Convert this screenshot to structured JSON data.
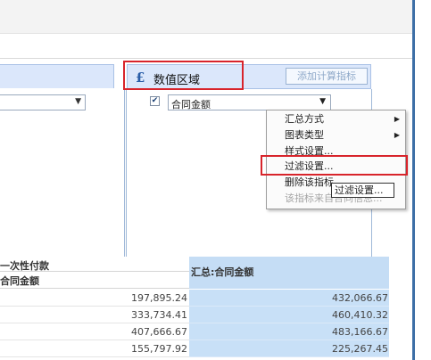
{
  "value_area": {
    "icon": "pound-icon",
    "title": "数值区域",
    "add_button": "添加计算指标",
    "field": {
      "checked": true,
      "label": "合同金额"
    }
  },
  "context_menu": {
    "items": [
      {
        "label": "汇总方式",
        "submenu": true,
        "enabled": true
      },
      {
        "label": "图表类型",
        "submenu": true,
        "enabled": true
      },
      {
        "label": "样式设置...",
        "submenu": false,
        "enabled": true
      },
      {
        "label": "过滤设置...",
        "submenu": false,
        "enabled": true
      },
      {
        "label": "删除该指标",
        "submenu": false,
        "enabled": true
      },
      {
        "label": "该指标来自合同信息...",
        "submenu": false,
        "enabled": false
      }
    ],
    "tooltip": "过滤设置..."
  },
  "table": {
    "left_header_line1": "一次性付款",
    "left_header_line2": "合同金额",
    "right_header": "汇总:合同金额",
    "rows": [
      {
        "left": "197,895.24",
        "right": "432,066.67"
      },
      {
        "left": "333,734.41",
        "right": "460,410.32"
      },
      {
        "left": "407,666.67",
        "right": "483,166.67"
      },
      {
        "left": "155,797.92",
        "right": "225,267.45"
      }
    ]
  },
  "highlight_color": "#d8242b",
  "accent_color": "#3d6fa6"
}
